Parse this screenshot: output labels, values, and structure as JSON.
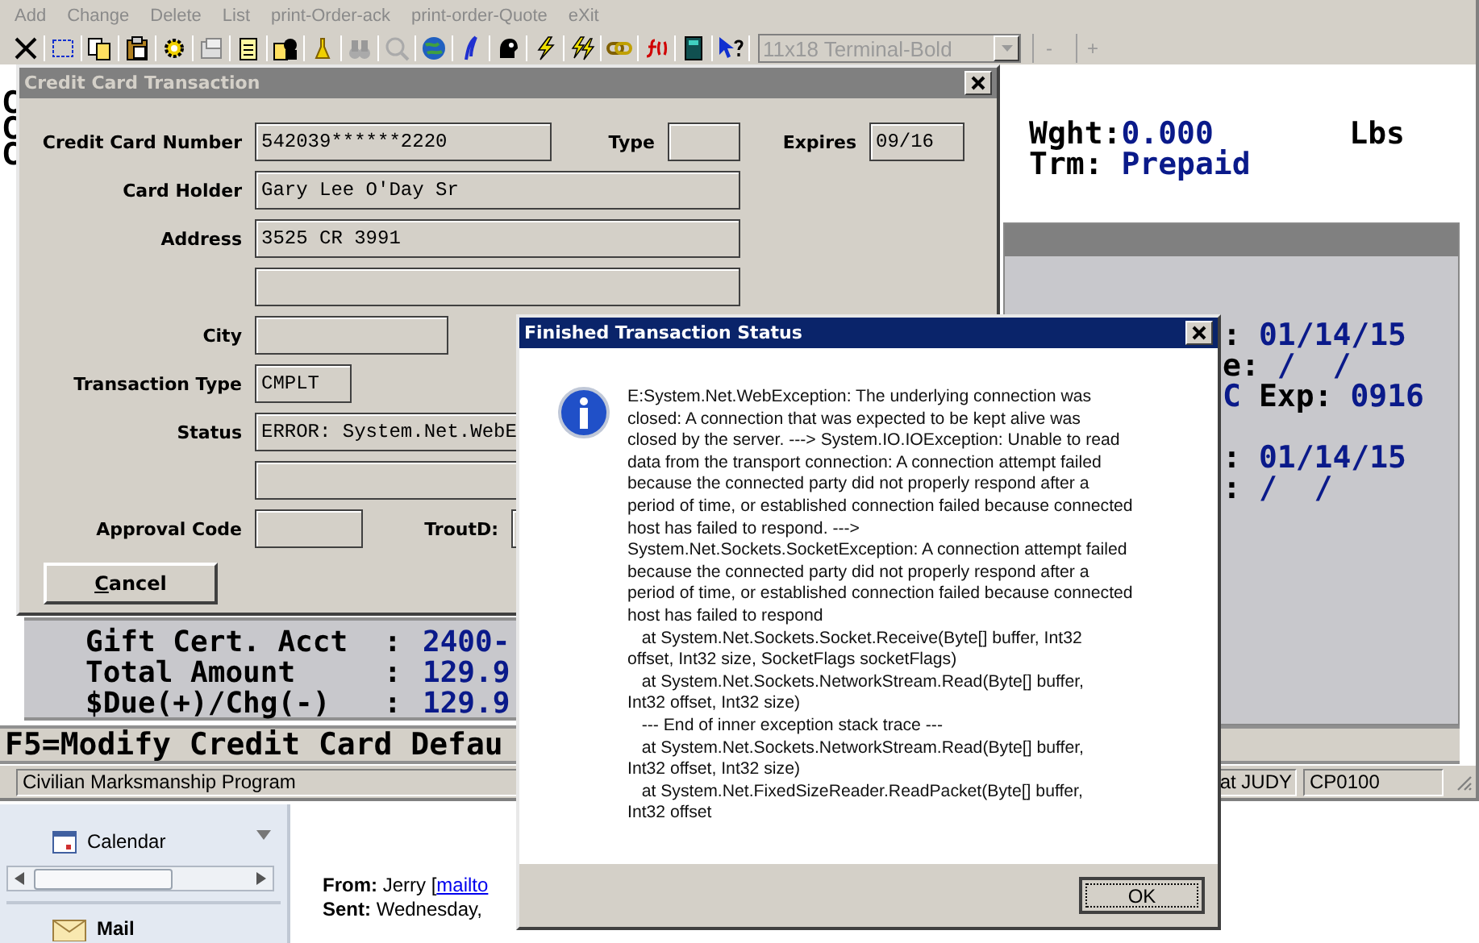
{
  "menu": [
    {
      "label": "Add",
      "disabled": true
    },
    {
      "label": "Change",
      "disabled": true
    },
    {
      "label": "Delete",
      "disabled": true
    },
    {
      "label": "List",
      "disabled": true
    },
    {
      "label": "print-Order-ack",
      "disabled": true
    },
    {
      "label": "print-order-Quote",
      "disabled": true
    },
    {
      "label": "eXit",
      "disabled": true
    }
  ],
  "toolbar": {
    "font_select": {
      "value": "11x18 Terminal-Bold",
      "disabled": true
    },
    "buttons": [
      "-",
      "+"
    ]
  },
  "terminal": {
    "left_chars": [
      "C",
      "C",
      "C"
    ],
    "weight": {
      "label": "Wght:",
      "value": "0.000",
      "unit": "Lbs"
    },
    "terms": {
      "label": "Trm:",
      "value": "Prepaid"
    },
    "panel_groups": [
      [
        [
          {
            "text": ":",
            "kind": "label"
          },
          {
            "text": "01/14/15",
            "kind": "value"
          }
        ],
        [
          {
            "text": "e:",
            "kind": "label"
          },
          {
            "text": "/  /",
            "kind": "value"
          }
        ],
        [
          {
            "text": "C",
            "kind": "value"
          },
          {
            "text": "Exp:",
            "kind": "label"
          },
          {
            "text": "0916",
            "kind": "value"
          }
        ]
      ],
      [
        [
          {
            "text": ":",
            "kind": "label"
          },
          {
            "text": "01/14/15",
            "kind": "value"
          }
        ],
        [
          {
            "text": ":",
            "kind": "label"
          },
          {
            "text": "/  /",
            "kind": "value"
          }
        ]
      ]
    ],
    "totals": [
      {
        "label": "Gift Cert. Acct",
        "sep": ":",
        "value": "2400-"
      },
      {
        "label": "Total Amount",
        "sep": ":",
        "value": "129.9"
      },
      {
        "label": "$Due(+)/Chg(-)",
        "sep": ":",
        "value": "129.9"
      }
    ],
    "function_key_hint": "F5=Modify Credit Card Defau"
  },
  "status_bar": [
    "Civilian Marksmanship Program",
    "at JUDY",
    "CP0100"
  ],
  "credit_dialog": {
    "title": "Credit Card Transaction",
    "rows": [
      [
        {
          "label": "Credit Card Number",
          "value": "542039******2220"
        },
        {
          "label": "Type"
        },
        {
          "label": "Expires",
          "value": "09/16"
        }
      ],
      [
        {
          "label": "Card Holder",
          "value": "Gary Lee O'Day Sr"
        }
      ],
      [
        {
          "label": "Address",
          "value": "3525 CR 3991"
        }
      ],
      [
        {}
      ],
      [
        {
          "label": "City"
        }
      ],
      [
        {
          "label": "Transaction Type",
          "value": "CMPLT"
        }
      ],
      [
        {
          "label": "Status",
          "value": "ERROR: System.Net.WebE"
        }
      ],
      [
        {}
      ],
      [
        {
          "label": "Approval Code"
        },
        {
          "label": "TroutD:"
        }
      ]
    ],
    "cancel": "Cancel"
  },
  "message_box": {
    "title": "Finished Transaction Status",
    "message": "E:System.Net.WebException: The underlying connection was\nclosed: A connection that was expected to be kept alive was\nclosed by the server. ---> System.IO.IOException: Unable to read\ndata from the transport connection: A connection attempt failed\nbecause the connected party did not properly respond after a\nperiod of time, or established connection failed because connected\nhost has failed to respond. --->\nSystem.Net.Sockets.SocketException: A connection attempt failed\nbecause the connected party did not properly respond after a\nperiod of time, or established connection failed because connected\nhost has failed to respond\n   at System.Net.Sockets.Socket.Receive(Byte[] buffer, Int32\noffset, Int32 size, SocketFlags socketFlags)\n   at System.Net.Sockets.NetworkStream.Read(Byte[] buffer,\nInt32 offset, Int32 size)\n   --- End of inner exception stack trace ---\n   at System.Net.Sockets.NetworkStream.Read(Byte[] buffer,\nInt32 offset, Int32 size)\n   at System.Net.FixedSizeReader.ReadPacket(Byte[] buffer,\nInt32 offset",
    "ok": "OK"
  },
  "mail": {
    "nav": [
      {
        "kind": "calendar",
        "label": "Calendar"
      },
      {
        "kind": "mail",
        "label": "Mail"
      }
    ],
    "from": {
      "text": "**From:** Jerry [",
      "link": "mailto"
    },
    "sent": {
      "text": "**Sent:** Wednesday,"
    }
  }
}
